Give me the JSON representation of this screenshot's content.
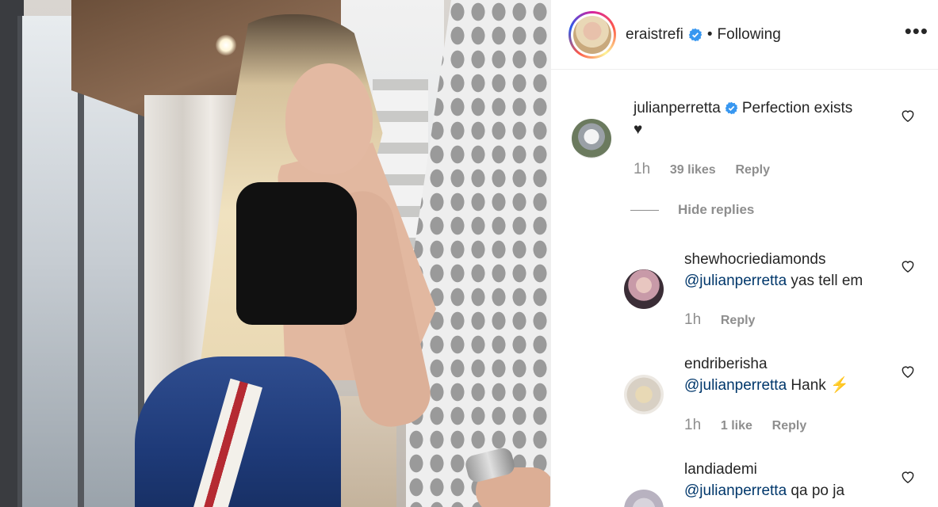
{
  "post_image": {
    "alt": ""
  },
  "header": {
    "username": "eraistrefi",
    "separator": "•",
    "follow_status": "Following",
    "more_label": "•••"
  },
  "comments": [
    {
      "username": "julianperretta",
      "verified": true,
      "text": "Perfection exists",
      "text_line2": "♥",
      "time": "1h",
      "likes": "39 likes",
      "reply_label": "Reply"
    }
  ],
  "hide_replies_label": "Hide replies",
  "replies": [
    {
      "username": "shewhocriediamonds",
      "mention": "@julianperretta",
      "text": " yas tell em",
      "time": "1h",
      "likes": "",
      "reply_label": "Reply"
    },
    {
      "username": "endriberisha",
      "mention": "@julianperretta",
      "text": " Hank ⚡",
      "time": "1h",
      "likes": "1 like",
      "reply_label": "Reply"
    },
    {
      "username": "landiademi",
      "mention": "@julianperretta",
      "text": " qa po ja",
      "time": "",
      "likes": "",
      "reply_label": ""
    }
  ],
  "colors": {
    "verified_blue": "#3897f0",
    "meta_gray": "#8e8e8e",
    "mention_blue": "#00376b",
    "text": "#262626"
  },
  "icons": {
    "verified": "verified-badge-icon",
    "heart": "heart-outline-icon",
    "more": "more-horizontal-icon"
  }
}
